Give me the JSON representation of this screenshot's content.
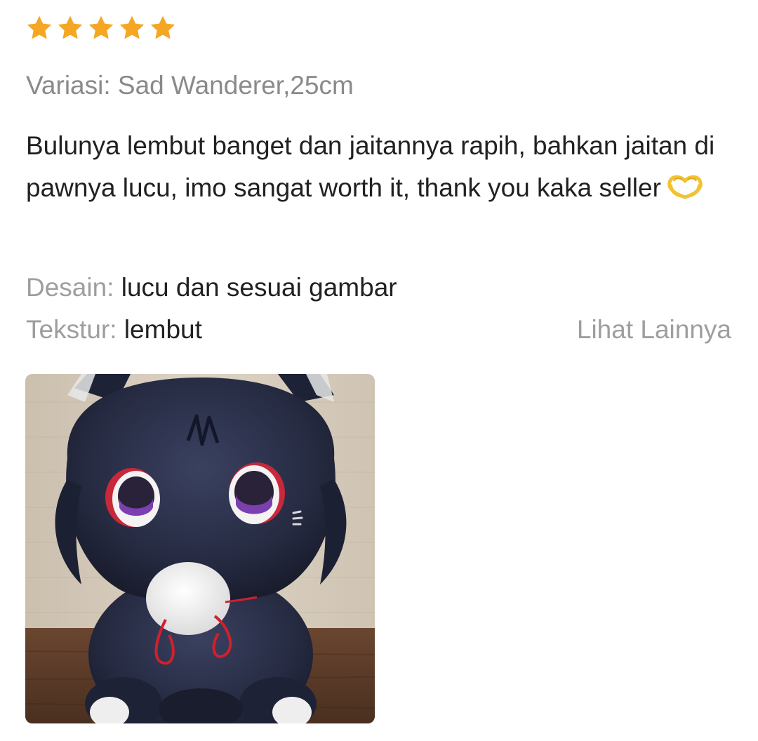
{
  "review": {
    "rating": 5,
    "rating_max": 5,
    "star_color": "#F5A623",
    "variation": {
      "label": "Variasi:",
      "value": "Sad Wanderer,25cm"
    },
    "comment": "Bulunya lembut banget dan jaitannya rapih, bahkan jaitan di pawnya lucu, imo sangat worth it, thank you kaka seller",
    "comment_emoji": "heart-hands-emoji",
    "attributes": [
      {
        "label": "Desain:",
        "value": "lucu dan sesuai gambar"
      },
      {
        "label": "Tekstur:",
        "value": "lembut"
      }
    ],
    "see_more_label": "Lihat Lainnya",
    "photos": [
      {
        "subject": "dark navy plush cat doll with purple eyes and white muzzle"
      }
    ]
  }
}
